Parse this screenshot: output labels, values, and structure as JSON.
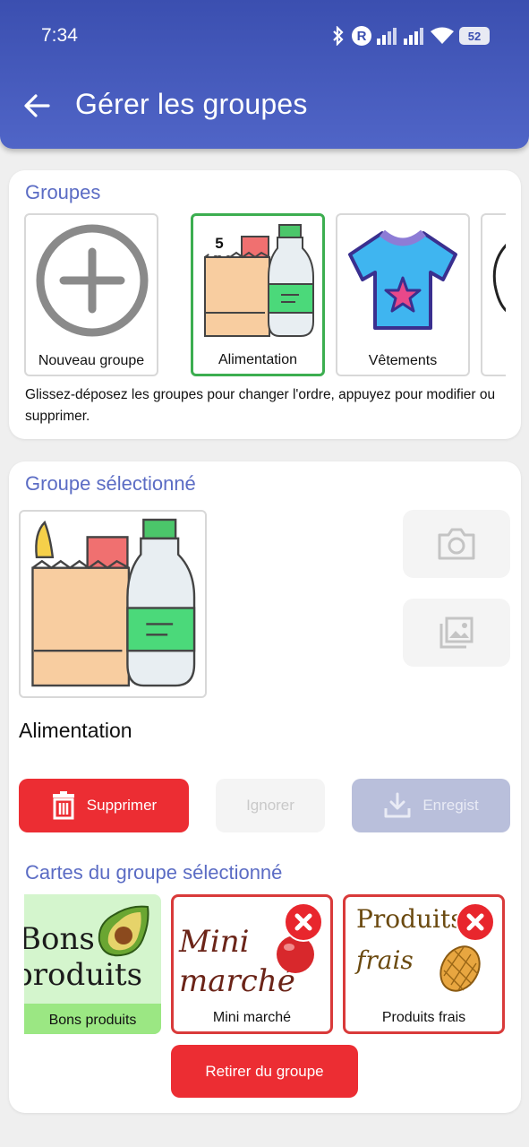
{
  "status_bar": {
    "time": "7:34",
    "battery": "52",
    "roaming_label": "R"
  },
  "header": {
    "title": "Gérer les groupes"
  },
  "groups_section": {
    "title": "Groupes",
    "tiles": [
      {
        "label": "Nouveau groupe"
      },
      {
        "label": "Alimentation",
        "badge": "5"
      },
      {
        "label": "Vêtements"
      }
    ],
    "hint": "Glissez-déposez les groupes pour changer l'ordre, appuyez pour modifier ou supprimer."
  },
  "selected_section": {
    "title": "Groupe sélectionné",
    "group_name": "Alimentation",
    "buttons": {
      "delete": "Supprimer",
      "ignore": "Ignorer",
      "save": "Enregist"
    }
  },
  "cards_section": {
    "title": "Cartes du groupe sélectionné",
    "cards": [
      {
        "label": "Bons produits",
        "image_text_1": "Bons",
        "image_text_2": "produits"
      },
      {
        "label": "Mini marché",
        "image_text_1": "Mini",
        "image_text_2": "marché"
      },
      {
        "label": "Produits frais",
        "image_text_1": "Produits",
        "image_text_2": "frais"
      }
    ],
    "remove_button": "Retirer du groupe"
  },
  "colors": {
    "header": "#3b4fb0",
    "accent_title": "#5b6cc4",
    "danger": "#ec2d33",
    "selected_border": "#3cae50"
  }
}
